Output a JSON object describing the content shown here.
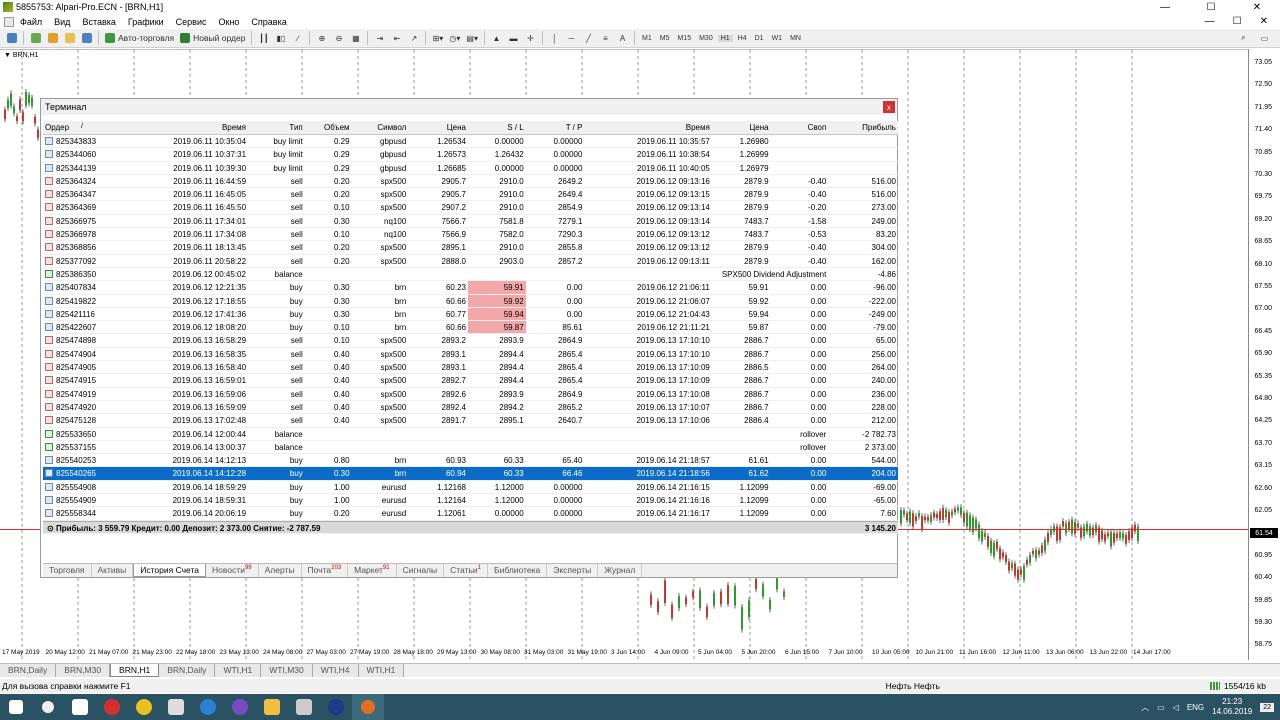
{
  "window": {
    "title": "5855753: Alpari-Pro.ECN - [BRN,H1]",
    "controls": [
      "—",
      "☐",
      "✕"
    ]
  },
  "menu": {
    "items": [
      "Файл",
      "Вид",
      "Вставка",
      "Графики",
      "Сервис",
      "Окно",
      "Справка"
    ]
  },
  "toolbar": {
    "autotrade_label": "Авто-торговля",
    "neworder_label": "Новый ордер",
    "timeframes": [
      "M1",
      "M5",
      "M15",
      "M30",
      "H1",
      "H4",
      "D1",
      "W1",
      "MN"
    ]
  },
  "chart": {
    "symbol_label": "BRN,H1",
    "price_labels": [
      "73.05",
      "72.50",
      "71.95",
      "71.40",
      "70.85",
      "70.30",
      "69.75",
      "69.20",
      "68.65",
      "68.10",
      "67.55",
      "67.00",
      "66.45",
      "65.90",
      "65.35",
      "64.80",
      "64.25",
      "63.70",
      "63.15",
      "62.60",
      "62.05",
      "61.54",
      "60.95",
      "60.40",
      "59.85",
      "59.30",
      "58.75"
    ],
    "current_price": "61.54",
    "time_labels": [
      "17 May 2019",
      "20 May 12:00",
      "21 May 07:00",
      "21 May 23:00",
      "22 May 18:00",
      "23 May 13:00",
      "24 May 08:00",
      "27 May 03:00",
      "27 May 19:00",
      "28 May 18:00",
      "29 May 13:00",
      "30 May 08:00",
      "31 May 03:00",
      "31 May 19:00",
      "3 Jun 14:00",
      "4 Jun 09:00",
      "5 Jun 04:00",
      "5 Jun 20:00",
      "6 Jun 15:00",
      "7 Jun 10:00",
      "10 Jun 05:00",
      "10 Jun 21:00",
      "11 Jun 16:00",
      "12 Jun 11:00",
      "13 Jun 06:00",
      "13 Jun 22:00",
      "14 Jun 17:00"
    ]
  },
  "terminal": {
    "title": "Терминал",
    "close": "x",
    "columns": [
      "Ордер",
      "Время",
      "Тип",
      "Объем",
      "Символ",
      "Цена",
      "S / L",
      "T / P",
      "Время",
      "Цена",
      "Своп",
      "Прибыль"
    ],
    "sort_mark": "/",
    "rows": [
      {
        "order": "825343833",
        "time": "2019.06.11 10:35:04",
        "type": "buy limit",
        "vol": "0.29",
        "sym": "gbpusd",
        "price": "1.26534",
        "sl": "0.00000",
        "tp": "0.00000",
        "ctime": "2019.06.11 10:35:57",
        "cprice": "1.26980",
        "swap": "",
        "profit": "",
        "kind": "buy"
      },
      {
        "order": "825344060",
        "time": "2019.06.11 10:37:31",
        "type": "buy limit",
        "vol": "0.29",
        "sym": "gbpusd",
        "price": "1.26573",
        "sl": "1.26432",
        "tp": "0.00000",
        "ctime": "2019.06.11 10:38:54",
        "cprice": "1.26999",
        "swap": "",
        "profit": "",
        "kind": "buy"
      },
      {
        "order": "825344139",
        "time": "2019.06.11 10:39:30",
        "type": "buy limit",
        "vol": "0.29",
        "sym": "gbpusd",
        "price": "1.26685",
        "sl": "0.00000",
        "tp": "0.00000",
        "ctime": "2019.06.11 10:40:05",
        "cprice": "1.26979",
        "swap": "",
        "profit": "",
        "kind": "buy"
      },
      {
        "order": "825364324",
        "time": "2019.06.11 16:44:59",
        "type": "sell",
        "vol": "0.20",
        "sym": "spx500",
        "price": "2905.7",
        "sl": "2910.0",
        "tp": "2649.2",
        "ctime": "2019.06.12 09:13:16",
        "cprice": "2879.9",
        "swap": "-0.40",
        "profit": "516.00",
        "kind": "sell"
      },
      {
        "order": "825364347",
        "time": "2019.06.11 16:45:05",
        "type": "sell",
        "vol": "0.20",
        "sym": "spx500",
        "price": "2905.7",
        "sl": "2910.0",
        "tp": "2649.4",
        "ctime": "2019.06.12 09:13:15",
        "cprice": "2879.9",
        "swap": "-0.40",
        "profit": "516.00",
        "kind": "sell"
      },
      {
        "order": "825364369",
        "time": "2019.06.11 16:45:50",
        "type": "sell",
        "vol": "0.10",
        "sym": "spx500",
        "price": "2907.2",
        "sl": "2910.0",
        "tp": "2854.9",
        "ctime": "2019.06.12 09:13:14",
        "cprice": "2879.9",
        "swap": "-0.20",
        "profit": "273.00",
        "kind": "sell"
      },
      {
        "order": "825366975",
        "time": "2019.06.11 17:34:01",
        "type": "sell",
        "vol": "0.30",
        "sym": "nq100",
        "price": "7566.7",
        "sl": "7581.8",
        "tp": "7279.1",
        "ctime": "2019.06.12 09:13:14",
        "cprice": "7483.7",
        "swap": "-1.58",
        "profit": "249.00",
        "kind": "sell"
      },
      {
        "order": "825366978",
        "time": "2019.06.11 17:34:08",
        "type": "sell",
        "vol": "0.10",
        "sym": "nq100",
        "price": "7566.9",
        "sl": "7582.0",
        "tp": "7290.3",
        "ctime": "2019.06.12 09:13:12",
        "cprice": "7483.7",
        "swap": "-0.53",
        "profit": "83.20",
        "kind": "sell"
      },
      {
        "order": "825368856",
        "time": "2019.06.11 18:13:45",
        "type": "sell",
        "vol": "0.20",
        "sym": "spx500",
        "price": "2895.1",
        "sl": "2910.0",
        "tp": "2855.8",
        "ctime": "2019.06.12 09:13:12",
        "cprice": "2879.9",
        "swap": "-0.40",
        "profit": "304.00",
        "kind": "sell"
      },
      {
        "order": "825377092",
        "time": "2019.06.11 20:58:22",
        "type": "sell",
        "vol": "0.20",
        "sym": "spx500",
        "price": "2888.0",
        "sl": "2903.0",
        "tp": "2857.2",
        "ctime": "2019.06.12 09:13:11",
        "cprice": "2879.9",
        "swap": "-0.40",
        "profit": "162.00",
        "kind": "sell"
      },
      {
        "order": "825386350",
        "time": "2019.06.12 00:45:02",
        "type": "balance",
        "vol": "",
        "sym": "",
        "price": "",
        "sl": "",
        "tp": "",
        "ctime": "",
        "cprice": "",
        "swap": "SPX500 Dividend Adjustment",
        "profit": "-4.86",
        "kind": "bal"
      },
      {
        "order": "825407834",
        "time": "2019.06.12 12:21:35",
        "type": "buy",
        "vol": "0.30",
        "sym": "brn",
        "price": "60.23",
        "sl": "59.91",
        "tp": "0.00",
        "ctime": "2019.06.12 21:06:11",
        "cprice": "59.91",
        "swap": "0.00",
        "profit": "-96.00",
        "kind": "buy",
        "hl": true
      },
      {
        "order": "825419822",
        "time": "2019.06.12 17:18:55",
        "type": "buy",
        "vol": "0.30",
        "sym": "brn",
        "price": "60.66",
        "sl": "59.92",
        "tp": "0.00",
        "ctime": "2019.06.12 21:06:07",
        "cprice": "59.92",
        "swap": "0.00",
        "profit": "-222.00",
        "kind": "buy",
        "hl": true
      },
      {
        "order": "825421116",
        "time": "2019.06.12 17:41:36",
        "type": "buy",
        "vol": "0.30",
        "sym": "brn",
        "price": "60.77",
        "sl": "59.94",
        "tp": "0.00",
        "ctime": "2019.06.12 21:04:43",
        "cprice": "59.94",
        "swap": "0.00",
        "profit": "-249.00",
        "kind": "buy",
        "hl": true
      },
      {
        "order": "825422607",
        "time": "2019.06.12 18:08:20",
        "type": "buy",
        "vol": "0.10",
        "sym": "brn",
        "price": "60.66",
        "sl": "59.87",
        "tp": "85.61",
        "ctime": "2019.06.12 21:11:21",
        "cprice": "59.87",
        "swap": "0.00",
        "profit": "-79.00",
        "kind": "buy",
        "hl": true
      },
      {
        "order": "825474898",
        "time": "2019.06.13 16:58:29",
        "type": "sell",
        "vol": "0.10",
        "sym": "spx500",
        "price": "2893.2",
        "sl": "2893.9",
        "tp": "2864.9",
        "ctime": "2019.06.13 17:10:10",
        "cprice": "2886.7",
        "swap": "0.00",
        "profit": "65.00",
        "kind": "sell"
      },
      {
        "order": "825474904",
        "time": "2019.06.13 16:58:35",
        "type": "sell",
        "vol": "0.40",
        "sym": "spx500",
        "price": "2893.1",
        "sl": "2894.4",
        "tp": "2865.4",
        "ctime": "2019.06.13 17:10:10",
        "cprice": "2886.7",
        "swap": "0.00",
        "profit": "256.00",
        "kind": "sell"
      },
      {
        "order": "825474905",
        "time": "2019.06.13 16:58:40",
        "type": "sell",
        "vol": "0.40",
        "sym": "spx500",
        "price": "2893.1",
        "sl": "2894.4",
        "tp": "2865.4",
        "ctime": "2019.06.13 17:10:09",
        "cprice": "2886.5",
        "swap": "0.00",
        "profit": "264.00",
        "kind": "sell"
      },
      {
        "order": "825474915",
        "time": "2019.06.13 16:59:01",
        "type": "sell",
        "vol": "0.40",
        "sym": "spx500",
        "price": "2892.7",
        "sl": "2894.4",
        "tp": "2865.4",
        "ctime": "2019.06.13 17:10:09",
        "cprice": "2886.7",
        "swap": "0.00",
        "profit": "240.00",
        "kind": "sell"
      },
      {
        "order": "825474919",
        "time": "2019.06.13 16:59:06",
        "type": "sell",
        "vol": "0.40",
        "sym": "spx500",
        "price": "2892.6",
        "sl": "2893.9",
        "tp": "2864.9",
        "ctime": "2019.06.13 17:10:08",
        "cprice": "2886.7",
        "swap": "0.00",
        "profit": "236.00",
        "kind": "sell"
      },
      {
        "order": "825474920",
        "time": "2019.06.13 16:59:09",
        "type": "sell",
        "vol": "0.40",
        "sym": "spx500",
        "price": "2892.4",
        "sl": "2894.2",
        "tp": "2865.2",
        "ctime": "2019.06.13 17:10:07",
        "cprice": "2886.7",
        "swap": "0.00",
        "profit": "228.00",
        "kind": "sell"
      },
      {
        "order": "825475128",
        "time": "2019.06.13 17:02:48",
        "type": "sell",
        "vol": "0.40",
        "sym": "spx500",
        "price": "2891.7",
        "sl": "2895.1",
        "tp": "2640.7",
        "ctime": "2019.06.13 17:10:06",
        "cprice": "2886.4",
        "swap": "0.00",
        "profit": "212.00",
        "kind": "sell"
      },
      {
        "order": "825533650",
        "time": "2019.06.14 12:00:44",
        "type": "balance",
        "vol": "",
        "sym": "",
        "price": "",
        "sl": "",
        "tp": "",
        "ctime": "",
        "cprice": "",
        "swap": "rollover",
        "profit": "-2 782.73",
        "kind": "bal"
      },
      {
        "order": "825537155",
        "time": "2019.06.14 13:00:37",
        "type": "balance",
        "vol": "",
        "sym": "",
        "price": "",
        "sl": "",
        "tp": "",
        "ctime": "",
        "cprice": "",
        "swap": "rollover",
        "profit": "2 373.00",
        "kind": "bal"
      },
      {
        "order": "825540253",
        "time": "2019.06.14 14:12:13",
        "type": "buy",
        "vol": "0.80",
        "sym": "brn",
        "price": "60.93",
        "sl": "60.33",
        "tp": "65.40",
        "ctime": "2019.06.14 21:18:57",
        "cprice": "61.61",
        "swap": "0.00",
        "profit": "544.00",
        "kind": "buy"
      },
      {
        "order": "825540265",
        "time": "2019.06.14 14:12:28",
        "type": "buy",
        "vol": "0.30",
        "sym": "brn",
        "price": "60.94",
        "sl": "60.33",
        "tp": "66.46",
        "ctime": "2019.06.14 21:18:56",
        "cprice": "61.62",
        "swap": "0.00",
        "profit": "204.00",
        "kind": "buy",
        "selected": true
      },
      {
        "order": "825554908",
        "time": "2019.06.14 18:59:29",
        "type": "buy",
        "vol": "1.00",
        "sym": "eurusd",
        "price": "1.12168",
        "sl": "1.12000",
        "tp": "0.00000",
        "ctime": "2019.06.14 21:16:15",
        "cprice": "1.12099",
        "swap": "0.00",
        "profit": "-69.00",
        "kind": "buy"
      },
      {
        "order": "825554909",
        "time": "2019.06.14 18:59:31",
        "type": "buy",
        "vol": "1.00",
        "sym": "eurusd",
        "price": "1.12164",
        "sl": "1.12000",
        "tp": "0.00000",
        "ctime": "2019.06.14 21:16:16",
        "cprice": "1.12099",
        "swap": "0.00",
        "profit": "-65.00",
        "kind": "buy"
      },
      {
        "order": "825558344",
        "time": "2019.06.14 20:06:19",
        "type": "buy",
        "vol": "0.20",
        "sym": "eurusd",
        "price": "1.12061",
        "sl": "0.00000",
        "tp": "0.00000",
        "ctime": "2019.06.14 21:16:17",
        "cprice": "1.12099",
        "swap": "0.00",
        "profit": "7.60",
        "kind": "buy"
      }
    ],
    "summary": {
      "text": "Прибыль: 3 559.79  Кредит: 0.00  Депозит: 2 373.00  Снятие: -2 787.59",
      "total": "3 145.20"
    },
    "tabs": [
      {
        "label": "Торговля",
        "badge": ""
      },
      {
        "label": "Активы",
        "badge": ""
      },
      {
        "label": "История Счета",
        "badge": "",
        "active": true
      },
      {
        "label": "Новости",
        "badge": "99"
      },
      {
        "label": "Алерты",
        "badge": ""
      },
      {
        "label": "Почта",
        "badge": "203"
      },
      {
        "label": "Маркет",
        "badge": "91"
      },
      {
        "label": "Сигналы",
        "badge": ""
      },
      {
        "label": "Статьи",
        "badge": "1"
      },
      {
        "label": "Библиотека",
        "badge": ""
      },
      {
        "label": "Эксперты",
        "badge": ""
      },
      {
        "label": "Журнал",
        "badge": ""
      }
    ]
  },
  "chart_tabs": [
    "BRN,Daily",
    "BRN,M30",
    "BRN,H1",
    "BRN,Daily",
    "WTI,H1",
    "WTI,M30",
    "WTI,H4",
    "WTI,H1"
  ],
  "chart_tabs_active": 2,
  "status": {
    "help": "Для вызова справки нажмите F1",
    "profile": "Нефть Нефть",
    "traffic": "1554/16 kb"
  },
  "taskbar": {
    "lang": "ENG",
    "time": "21:23",
    "date": "14.06.2019",
    "notif": "22"
  }
}
